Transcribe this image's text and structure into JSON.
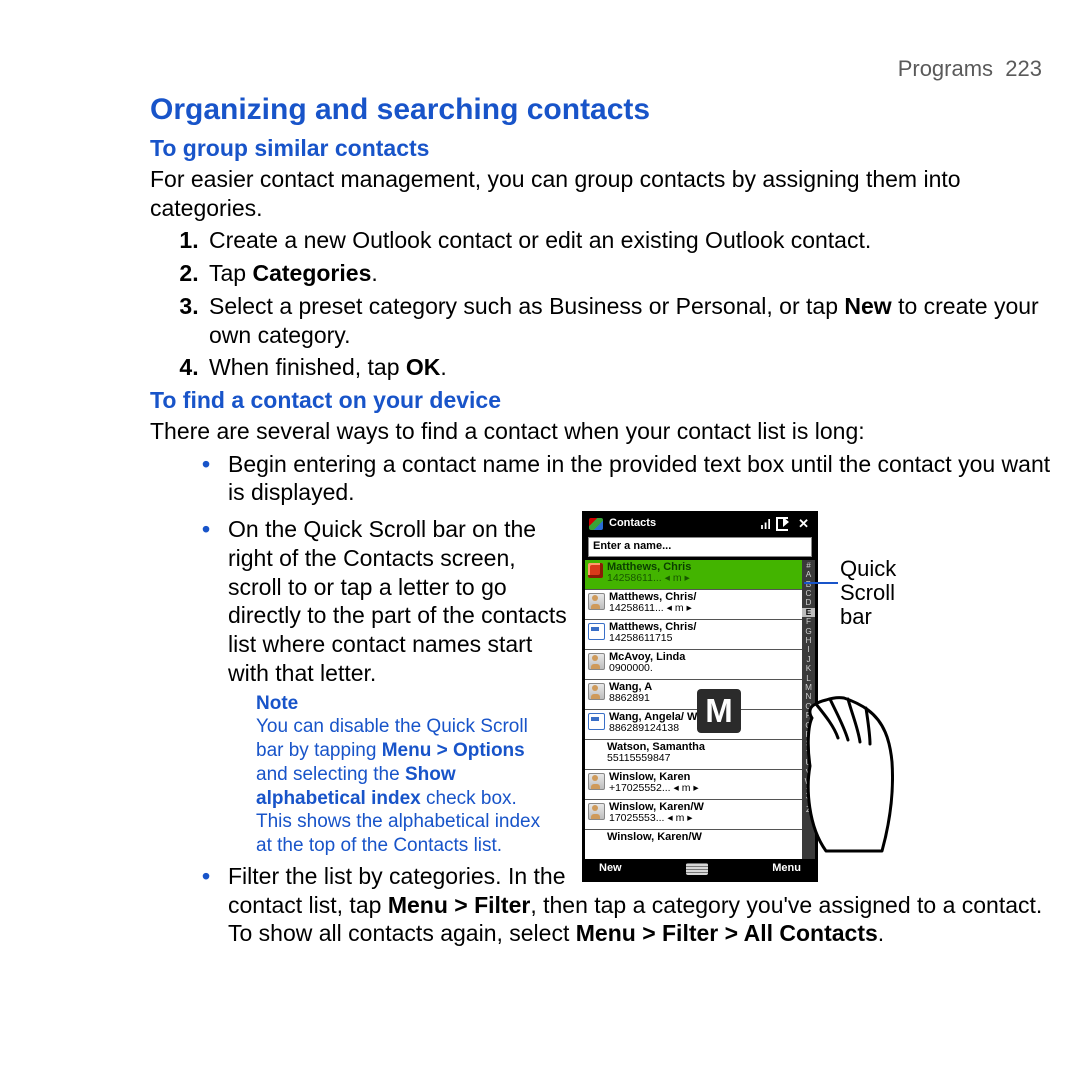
{
  "header": {
    "section": "Programs",
    "page": "223"
  },
  "h1": "Organizing and searching contacts",
  "sec1": {
    "title": "To group similar contacts",
    "intro": "For easier contact management, you can group contacts by assigning them into categories.",
    "steps": {
      "s1": "Create a new Outlook contact or edit an existing Outlook contact.",
      "s2a": "Tap ",
      "s2b": "Categories",
      "s2c": ".",
      "s3a": "Select a preset category such as Business or Personal, or tap ",
      "s3b": "New",
      "s3c": " to create your own category.",
      "s4a": "When finished, tap ",
      "s4b": "OK",
      "s4c": "."
    }
  },
  "sec2": {
    "title": "To find a contact on your device",
    "intro": "There are several ways to find a contact when your contact list is long:",
    "b1": "Begin entering a contact name in the provided text box until the contact you want is displayed.",
    "b2": "On the Quick Scroll bar on the right of the Contacts screen, scroll to or tap a letter to go directly to the part of the contacts list where contact names start with that letter.",
    "noteLabel": "Note",
    "note_a": "You can disable the Quick Scroll bar by tapping ",
    "note_b": "Menu > Options",
    "note_c": " and selecting the ",
    "note_d": "Show alphabetical index",
    "note_e": " check box. This shows the alphabetical index at the top of the Contacts list.",
    "b3a": "Filter the list by categories. In the contact list, tap ",
    "b3b": "Menu > Filter",
    "b3c": ", then tap a category you've assigned to a contact. To show all contacts again, select ",
    "b3d": "Menu > Filter > All Contacts",
    "b3e": "."
  },
  "phone": {
    "title": "Contacts",
    "placeholder": "Enter a name...",
    "softLeft": "New",
    "softRight": "Menu",
    "overlayLetter": "M",
    "quickbar": [
      "#",
      "A",
      "B",
      "C",
      "D",
      "E",
      "F",
      "G",
      "H",
      "I",
      "J",
      "K",
      "L",
      "M",
      "N",
      "O",
      "P",
      "Q",
      "R",
      "S",
      "T",
      "U",
      "V",
      "W",
      "X",
      "Y",
      "Z"
    ],
    "rows": [
      {
        "name": "Matthews, Chris",
        "num": "14258611...",
        "m": true,
        "sel": true,
        "icon": "led"
      },
      {
        "name": "Matthews, Chris/",
        "num": "14258611...",
        "m": true,
        "icon": "person"
      },
      {
        "name": "Matthews, Chris/",
        "num": "14258611715",
        "icon": "card"
      },
      {
        "name": "McAvoy, Linda",
        "num": "0900000.",
        "icon": "person",
        "cut": true
      },
      {
        "name": "Wang, A",
        "num": "8862891",
        "icon": "person",
        "cut": true
      },
      {
        "name": "Wang, Angela/ W",
        "num": "886289124138",
        "icon": "card"
      },
      {
        "name": "Watson, Samantha",
        "num": "55115559847",
        "icon": "blank"
      },
      {
        "name": "Winslow, Karen",
        "num": "+17025552...",
        "m": true,
        "icon": "person"
      },
      {
        "name": "Winslow, Karen/W",
        "num": "17025553...",
        "m": true,
        "icon": "person"
      },
      {
        "name": "Winslow, Karen/W",
        "num": "",
        "icon": "blank",
        "last": true
      }
    ]
  },
  "callout": {
    "l1": "Quick",
    "l2": "Scroll",
    "l3": "bar"
  }
}
